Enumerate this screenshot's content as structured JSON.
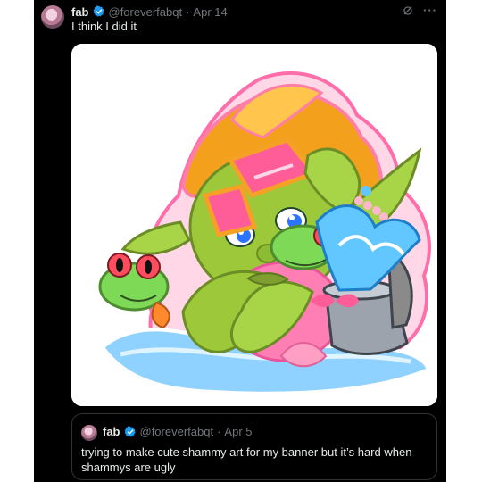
{
  "post": {
    "author_name": "fab",
    "handle": "@foreverfabqt",
    "separator": "·",
    "date": "Apr 14",
    "text": "I think I did it",
    "more_label": "···"
  },
  "quoted_post": {
    "author_name": "fab",
    "handle": "@foreverfabqt",
    "separator": "·",
    "date": "Apr 5",
    "text": "trying to make cute shammy art for my banner but it’s hard when shammys are ugly"
  },
  "colors": {
    "background": "#000000",
    "text": "#e7e9ea",
    "muted": "#71767b",
    "verified": "#1d9bf0"
  },
  "icons": [
    "verified-badge-icon",
    "grok-icon",
    "more-options-icon"
  ]
}
